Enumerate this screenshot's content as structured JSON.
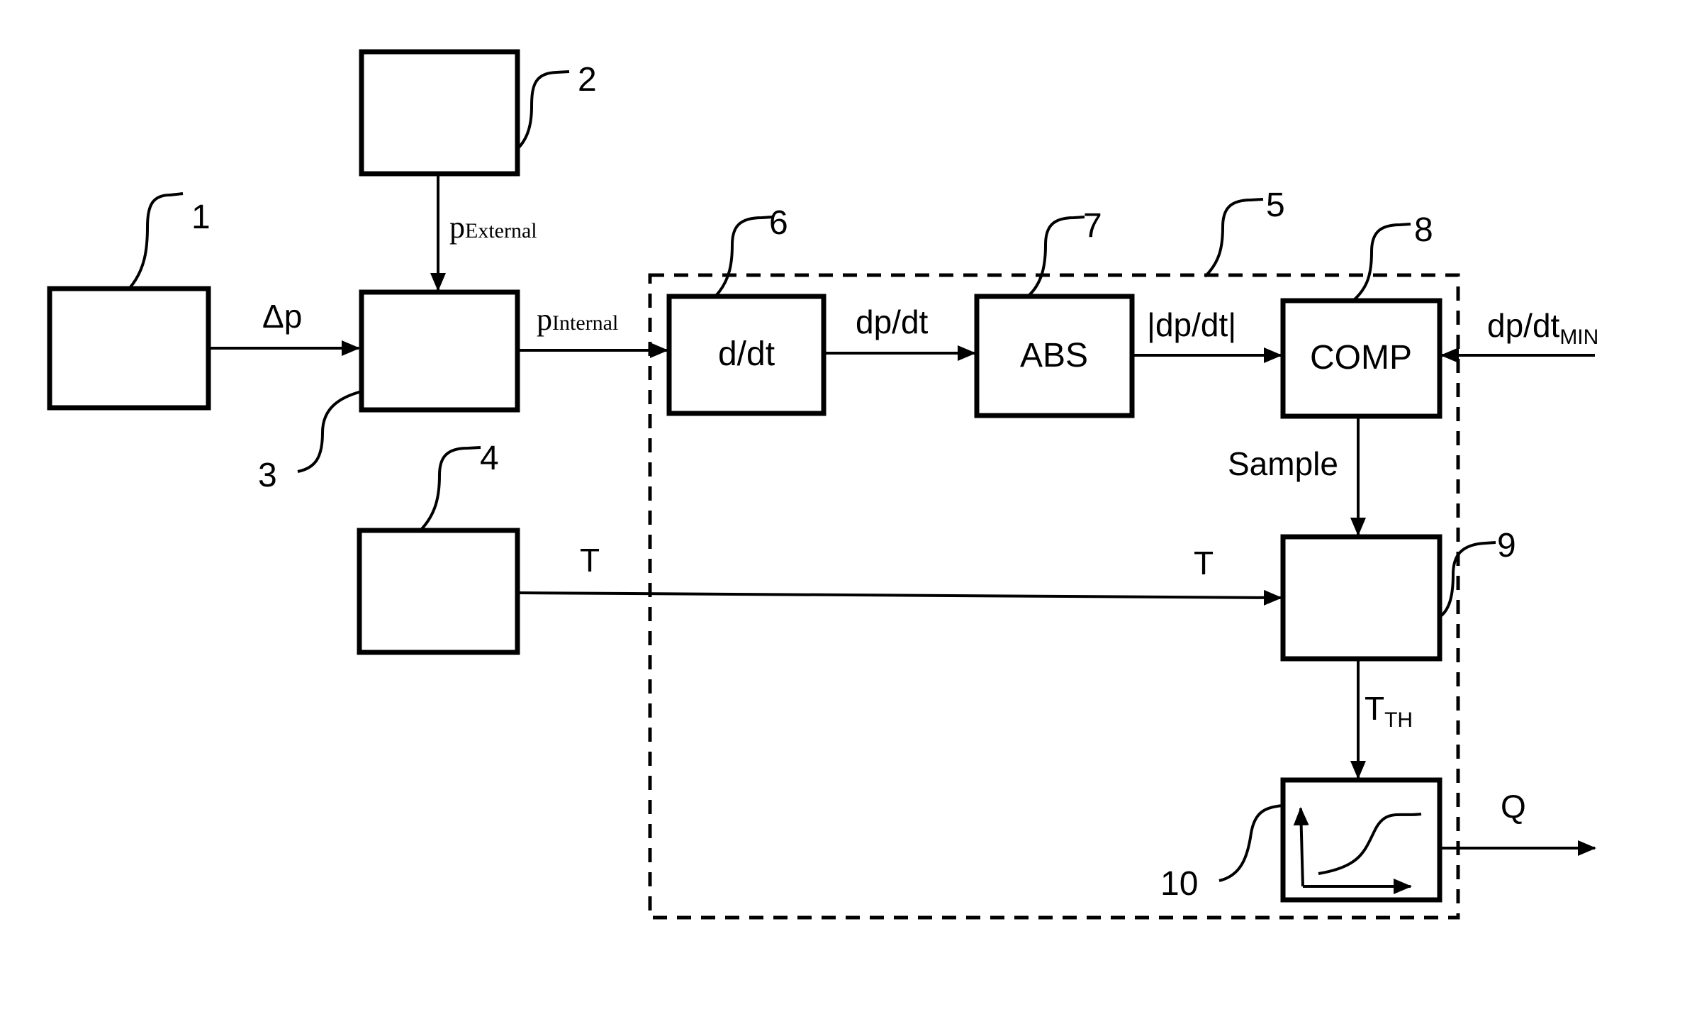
{
  "diagram": {
    "type": "block-diagram",
    "blocks": [
      {
        "id": "1",
        "ref": "1",
        "label": ""
      },
      {
        "id": "2",
        "ref": "2",
        "label": ""
      },
      {
        "id": "3",
        "ref": "3",
        "label": ""
      },
      {
        "id": "4",
        "ref": "4",
        "label": ""
      },
      {
        "id": "5",
        "ref": "5",
        "label": "",
        "style": "dashed-container"
      },
      {
        "id": "6",
        "ref": "6",
        "label": "d/dt"
      },
      {
        "id": "7",
        "ref": "7",
        "label": "ABS"
      },
      {
        "id": "8",
        "ref": "8",
        "label": "COMP"
      },
      {
        "id": "9",
        "ref": "9",
        "label": ""
      },
      {
        "id": "10",
        "ref": "10",
        "label": "",
        "icon": "sigmoid-curve-graph"
      }
    ],
    "signals": {
      "delta_p": "Δp",
      "p_external_main": "p",
      "p_external_sub": "External",
      "p_internal_main": "p",
      "p_internal_sub": "Internal",
      "dpdt": "dp/dt",
      "abs_dpdt": "|dp/dt|",
      "dpdt_min_main": "dp/dt",
      "dpdt_min_sub": "MIN",
      "sample": "Sample",
      "T_left": "T",
      "T_right": "T",
      "T_th_main": "T",
      "T_th_sub": "TH",
      "Q": "Q"
    },
    "connections": [
      {
        "from": "1",
        "to": "3",
        "signal": "Δp"
      },
      {
        "from": "2",
        "to": "3",
        "signal": "pExternal"
      },
      {
        "from": "3",
        "to": "6",
        "signal": "pInternal"
      },
      {
        "from": "6",
        "to": "7",
        "signal": "dp/dt"
      },
      {
        "from": "7",
        "to": "8",
        "signal": "|dp/dt|"
      },
      {
        "from": "external",
        "to": "8",
        "signal": "dp/dtMIN"
      },
      {
        "from": "8",
        "to": "9",
        "signal": "Sample"
      },
      {
        "from": "4",
        "to": "9",
        "signal": "T"
      },
      {
        "from": "9",
        "to": "10",
        "signal": "TTH"
      },
      {
        "from": "10",
        "to": "output",
        "signal": "Q"
      }
    ]
  }
}
